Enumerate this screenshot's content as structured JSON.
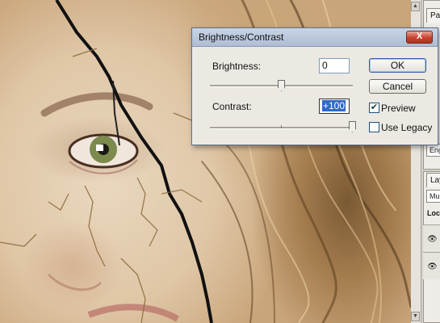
{
  "dialog": {
    "title": "Brightness/Contrast",
    "close_label": "X",
    "brightness": {
      "label": "Brightness:",
      "value": "0",
      "slider_position": 0.5
    },
    "contrast": {
      "label": "Contrast:",
      "value": "+100",
      "slider_position": 1.0
    },
    "ok_label": "OK",
    "cancel_label": "Cancel",
    "preview": {
      "label": "Preview",
      "checked": true
    },
    "use_legacy": {
      "label": "Use Legacy",
      "checked": false
    }
  },
  "panels": {
    "paths_tab": "Paths",
    "layers_tab": "Layers",
    "blend_mode": "Multiply",
    "lock_label": "Lock:",
    "channel_field": "Eng"
  },
  "icons": {
    "visibility": "eye-icon",
    "checkmark": "checkmark-icon",
    "scroll_up": "arrow-up-icon",
    "scroll_down": "arrow-down-icon"
  }
}
